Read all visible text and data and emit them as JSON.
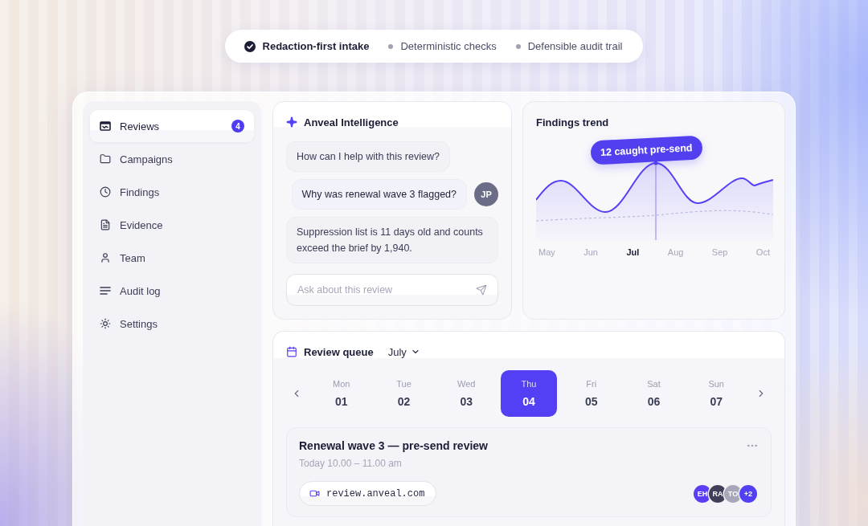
{
  "highlights": [
    {
      "label": "Redaction-first intake",
      "kind": "check"
    },
    {
      "label": "Deterministic checks",
      "kind": "dot"
    },
    {
      "label": "Defensible audit trail",
      "kind": "dot"
    }
  ],
  "sidebar": {
    "items": [
      {
        "label": "Reviews",
        "selected": true,
        "badge": "4"
      },
      {
        "label": "Campaigns",
        "selected": false
      },
      {
        "label": "Findings",
        "selected": false
      },
      {
        "label": "Evidence",
        "selected": false
      },
      {
        "label": "Team",
        "selected": false
      },
      {
        "label": "Audit log",
        "selected": false
      },
      {
        "label": "Settings",
        "selected": false
      }
    ]
  },
  "assistant": {
    "title": "Anveal Intelligence",
    "messages": [
      {
        "kind": "assistant",
        "text": "How can I help with this review?"
      },
      {
        "kind": "user",
        "text": "Why was renewal wave 3 flagged?",
        "avatar": "JP"
      },
      {
        "kind": "assistant",
        "text": "Suppression list is 11 days old and counts exceed the brief by 1,940."
      }
    ],
    "input": {
      "placeholder": "Ask about this review"
    }
  },
  "findings_trend": {
    "title": "Findings trend",
    "callout": "12 caught pre-send",
    "months": [
      {
        "label": "May",
        "selected": false
      },
      {
        "label": "Jun",
        "selected": false
      },
      {
        "label": "Jul",
        "selected": true
      },
      {
        "label": "Aug",
        "selected": false
      },
      {
        "label": "Sep",
        "selected": false
      },
      {
        "label": "Oct",
        "selected": false
      }
    ]
  },
  "review_queue": {
    "title": "Review queue",
    "month": "July",
    "days": [
      {
        "weekday": "Mon",
        "date": "01",
        "selected": false
      },
      {
        "weekday": "Tue",
        "date": "02",
        "selected": false
      },
      {
        "weekday": "Wed",
        "date": "03",
        "selected": false
      },
      {
        "weekday": "Thu",
        "date": "04",
        "selected": true
      },
      {
        "weekday": "Fri",
        "date": "05",
        "selected": false
      },
      {
        "weekday": "Sat",
        "date": "06",
        "selected": false
      },
      {
        "weekday": "Sun",
        "date": "07",
        "selected": false
      }
    ],
    "event": {
      "title": "Renewal wave 3 — pre-send review",
      "time": "Today 10.00 – 11.00 am",
      "link": "review.anveal.com",
      "attendees": [
        {
          "initials": "EH",
          "color": "#5b3df5"
        },
        {
          "initials": "RA",
          "color": "#3f3f58"
        },
        {
          "initials": "TO",
          "color": "#a7a7b9"
        }
      ],
      "more": "+2"
    }
  }
}
